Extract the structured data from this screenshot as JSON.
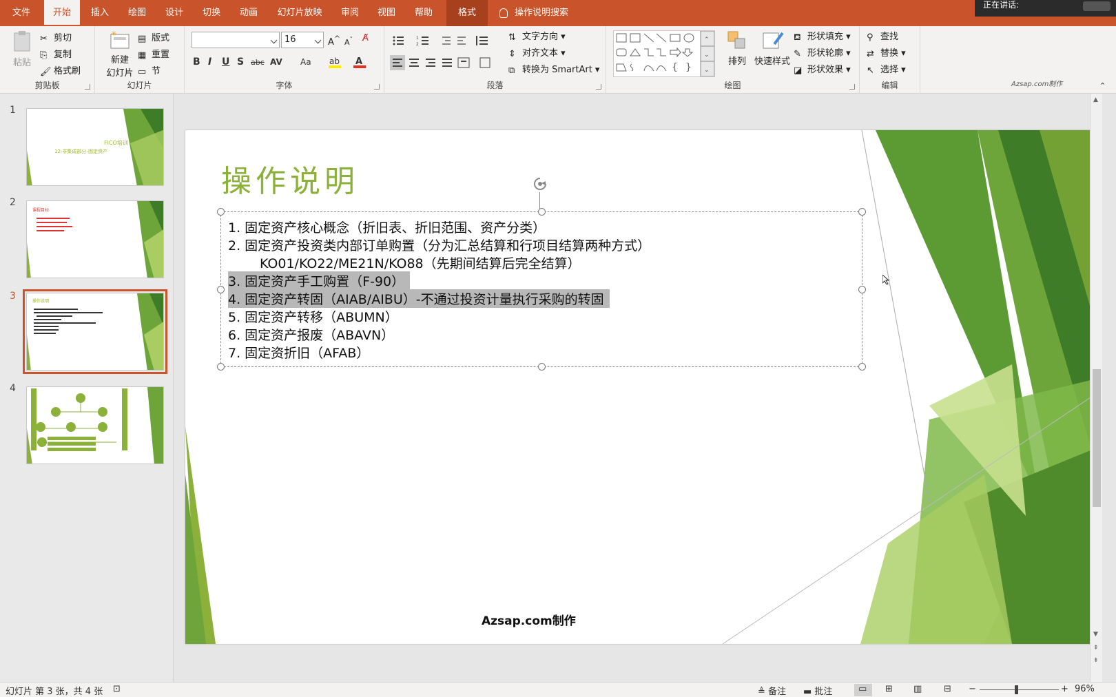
{
  "tabs": [
    {
      "label": "文件"
    },
    {
      "label": "开始"
    },
    {
      "label": "插入"
    },
    {
      "label": "绘图"
    },
    {
      "label": "设计"
    },
    {
      "label": "切换"
    },
    {
      "label": "动画"
    },
    {
      "label": "幻灯片放映"
    },
    {
      "label": "审阅"
    },
    {
      "label": "视图"
    },
    {
      "label": "帮助"
    },
    {
      "label": "格式"
    }
  ],
  "tell_me": "操作说明搜索",
  "speaking": "正在讲话:",
  "ribbon": {
    "clipboard": {
      "paste": "粘贴",
      "cut": "剪切",
      "copy": "复制",
      "format_painter": "格式刷",
      "label": "剪贴板"
    },
    "slides": {
      "new_slide": "新建",
      "new_slide2": "幻灯片",
      "layout": "版式",
      "reset": "重置",
      "section": "节",
      "label": "幻灯片"
    },
    "font": {
      "name_value": "",
      "size_value": "16",
      "bold": "B",
      "italic": "I",
      "underline": "U",
      "shadow": "S",
      "strike": "abc",
      "spacing": "AV",
      "case": "Aa",
      "label": "字体"
    },
    "paragraph": {
      "text_direction": "文字方向",
      "align_text": "对齐文本",
      "smartart": "转换为 SmartArt",
      "label": "段落"
    },
    "drawing": {
      "arrange": "排列",
      "quick_styles": "快速样式",
      "shape_fill": "形状填充",
      "shape_outline": "形状轮廓",
      "shape_effects": "形状效果",
      "label": "绘图"
    },
    "editing": {
      "find": "查找",
      "replace": "替换",
      "select": "选择",
      "label": "编辑"
    },
    "watermark": "Azsap.com制作"
  },
  "thumbnails": [
    {
      "num": "1",
      "title": "FICO培训",
      "subtitle": "12-非集成部分-固定资产"
    },
    {
      "num": "2",
      "title": "课程目标"
    },
    {
      "num": "3",
      "title": "操作说明"
    },
    {
      "num": "4"
    }
  ],
  "slide": {
    "title": "操作说明",
    "lines": [
      "1.  固定资产核心概念（折旧表、折旧范围、资产分类）",
      "2.  固定资产投资类内部订单购置（分为汇总结算和行项目结算两种方式）",
      "KO01/KO22/ME21N/KO88（先期间结算后完全结算）",
      "3. 固定资产手工购置（F-90）",
      "4. 固定资产转固（AIAB/AIBU）-不通过投资计量执行采购的转固",
      "5. 固定资产转移（ABUMN）",
      "6. 固定资产报废（ABAVN）",
      "7. 固定资折旧（AFAB）"
    ],
    "footer": "Azsap.com制作"
  },
  "status": {
    "slide_info": "幻灯片 第 3 张，共 4 张",
    "notes": "备注",
    "comments": "批注",
    "zoom": "96%"
  },
  "colors": {
    "accent": "#c9532b",
    "title_green": "#8cb13a"
  }
}
